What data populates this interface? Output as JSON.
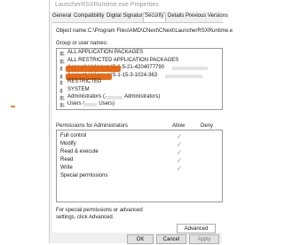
{
  "window": {
    "title": "LauncherRSXRuntime.exe Properties"
  },
  "tabs": [
    "General",
    "Compatibility",
    "Digital Signatures",
    "Security",
    "Details",
    "Previous Versions"
  ],
  "object": {
    "label": "Object name:",
    "value": "C:\\Program Files\\AMD\\CNext\\CNext\\LauncherRSXRuntime.e"
  },
  "groups": {
    "label": "Group or user names:",
    "items": [
      {
        "name": "ALL APPLICATION PACKAGES"
      },
      {
        "name": "ALL RESTRICTED APPLICATION PACKAGES"
      },
      {
        "name": "Account Unknown(S-1-5-21-4204077790"
      },
      {
        "name": "Account Unknown(S-1-15-3-1024-363"
      },
      {
        "name": "RESTRICTED"
      },
      {
        "name": "SYSTEM"
      },
      {
        "name": "Administrators (",
        "suffix": "Administrators)"
      },
      {
        "name": "Users (",
        "suffix": "Users)"
      }
    ]
  },
  "permissions": {
    "label": "Permissions for Administrators",
    "allow_header": "Allow",
    "deny_header": "Deny",
    "items": [
      {
        "name": "Full control",
        "allow": true
      },
      {
        "name": "Modify",
        "allow": true
      },
      {
        "name": "Read & execute",
        "allow": true
      },
      {
        "name": "Read",
        "allow": true
      },
      {
        "name": "Write",
        "allow": true
      },
      {
        "name": "Special permissions",
        "allow": false
      }
    ]
  },
  "special": {
    "text": "For special permissions or advanced settings, click Advanced.",
    "advanced_label": "Advanced"
  },
  "footer": {
    "ok": "OK",
    "cancel": "Cancel",
    "apply": "Apply"
  },
  "colors": {
    "redaction": "#e86a14",
    "accent": "#f57c2a"
  },
  "icons": {
    "user": "user-group-icon",
    "check": "check-icon"
  }
}
